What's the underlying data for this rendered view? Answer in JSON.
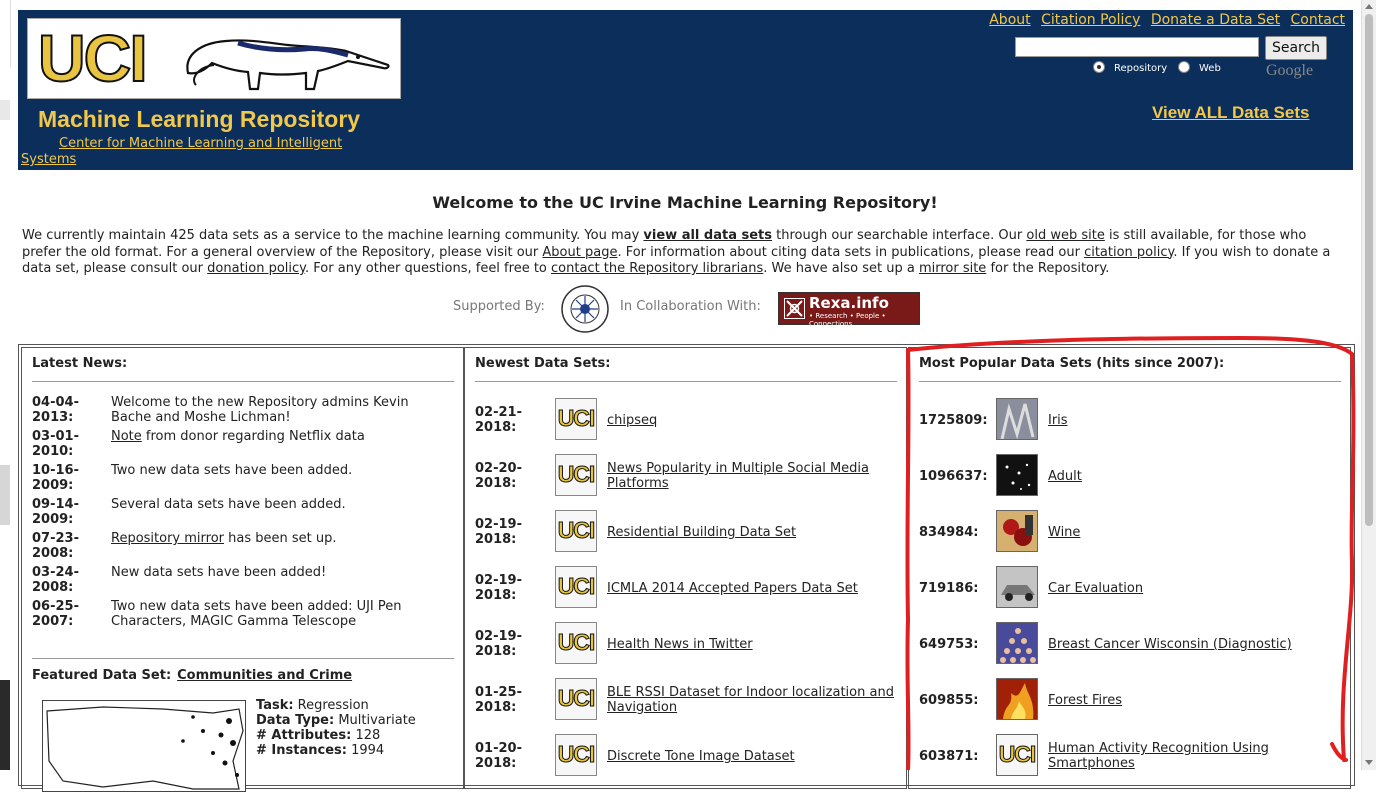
{
  "header": {
    "logo_text": "UCI",
    "title": "Machine Learning Repository",
    "subtitle_line1": "Center for Machine Learning and Intelligent",
    "subtitle_line2": "Systems",
    "top_links": [
      "About",
      "Citation Policy",
      "Donate a Data Set",
      "Contact"
    ],
    "search": {
      "value": "",
      "button": "Search",
      "radio_repository": "Repository",
      "radio_web": "Web",
      "selected": "Repository"
    },
    "google_label": "Google",
    "view_all": "View ALL Data Sets"
  },
  "welcome": "Welcome to the UC Irvine Machine Learning Repository!",
  "intro": {
    "t1": "We currently maintain 425 data sets as a service to the machine learning community. You may ",
    "l1": "view all data sets",
    "t2": " through our searchable interface. Our ",
    "l2": "old web site",
    "t3": " is still available, for those who prefer the old format. For a general overview of the Repository, please visit our ",
    "l3": "About page",
    "t4": ". For information about citing data sets in publications, please read our ",
    "l4": "citation policy",
    "t5": ". If you wish to donate a data set, please consult our ",
    "l5": "donation policy",
    "t6": ". For any other questions, feel free to ",
    "l6": "contact the Repository librarians",
    "t7": ". We have also set up a ",
    "l7": "mirror site",
    "t8": " for the Repository."
  },
  "support": {
    "supported_by": "Supported By:",
    "collab": "In Collaboration With:",
    "rexa_name": "Rexa.info",
    "rexa_sub": "• Research • People • Connections"
  },
  "latest_news": {
    "heading": "Latest News:",
    "items": [
      {
        "d1": "04-04-",
        "d2": "2013:",
        "text": "Welcome to the new Repository admins Kevin Bache and Moshe Lichman!"
      },
      {
        "d1": "03-01-",
        "d2": "2010:",
        "link": "Note",
        "text": " from donor regarding Netflix data"
      },
      {
        "d1": "10-16-",
        "d2": "2009:",
        "text": "Two new data sets have been added."
      },
      {
        "d1": "09-14-",
        "d2": "2009:",
        "text": "Several data sets have been added."
      },
      {
        "d1": "07-23-",
        "d2": "2008:",
        "link": "Repository mirror",
        "text": " has been set up."
      },
      {
        "d1": "03-24-",
        "d2": "2008:",
        "text": "New data sets have been added!"
      },
      {
        "d1": "06-25-",
        "d2": "2007:",
        "text": "Two new data sets have been added: UJI Pen Characters, MAGIC Gamma Telescope"
      }
    ]
  },
  "featured": {
    "label": "Featured Data Set:",
    "name": "Communities and Crime",
    "task_label": "Task:",
    "task": " Regression",
    "type_label": "Data Type:",
    "type": " Multivariate",
    "attr_label": "# Attributes:",
    "attr": " 128",
    "inst_label": "# Instances:",
    "inst": " 1994"
  },
  "newest": {
    "heading": "Newest Data Sets:",
    "items": [
      {
        "d1": "02-21-",
        "d2": "2018:",
        "name": "chipseq"
      },
      {
        "d1": "02-20-",
        "d2": "2018:",
        "name": "News Popularity in Multiple Social Media Platforms"
      },
      {
        "d1": "02-19-",
        "d2": "2018:",
        "name": "Residential Building Data Set"
      },
      {
        "d1": "02-19-",
        "d2": "2018:",
        "name": "ICMLA 2014 Accepted Papers Data Set"
      },
      {
        "d1": "02-19-",
        "d2": "2018:",
        "name": "Health News in Twitter"
      },
      {
        "d1": "01-25-",
        "d2": "2018:",
        "name": "BLE RSSI Dataset for Indoor localization and Navigation"
      },
      {
        "d1": "01-20-",
        "d2": "2018:",
        "name": "Discrete Tone Image Dataset"
      }
    ]
  },
  "popular": {
    "heading": "Most Popular Data Sets (hits since 2007):",
    "items": [
      {
        "count": "1725809:",
        "name": "Iris",
        "thumb": "iris"
      },
      {
        "count": "1096637:",
        "name": "Adult",
        "thumb": "adult"
      },
      {
        "count": "834984:",
        "name": "Wine",
        "thumb": "wine"
      },
      {
        "count": "719186:",
        "name": "Car Evaluation",
        "thumb": "car"
      },
      {
        "count": "649753:",
        "name": "Breast Cancer Wisconsin (Diagnostic)",
        "thumb": "cancer"
      },
      {
        "count": "609855:",
        "name": "Forest Fires",
        "thumb": "fire"
      },
      {
        "count": "603871:",
        "name": "Human Activity Recognition Using Smartphones",
        "thumb": "uci"
      }
    ]
  },
  "colors": {
    "header_bg": "#0b2e5a",
    "accent_gold": "#f2c84b",
    "annotation_red": "#e02020"
  }
}
